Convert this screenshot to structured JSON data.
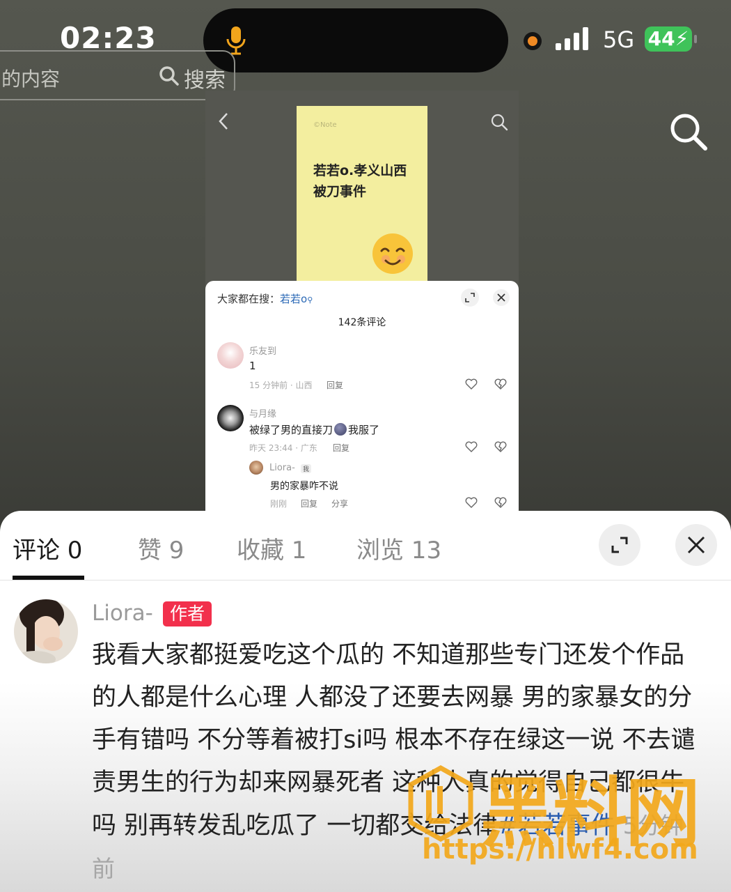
{
  "status_bar": {
    "time": "02:23",
    "network": "5G",
    "battery": "44"
  },
  "background": {
    "search_placeholder": "的内容",
    "search_button": "搜索"
  },
  "embedded": {
    "note_mark": "©Note",
    "note_title": "若若o.孝义山西被刀事件",
    "search_hint_prefix": "大家都在搜：",
    "search_hint_term": "若若o",
    "comment_count": "142条评论",
    "comments": [
      {
        "user": "乐友到",
        "text": "1",
        "meta": "15 分钟前 · 山西",
        "reply": "回复"
      },
      {
        "user": "与月缘",
        "text_before": "被绿了男的直接刀",
        "text_after": "我服了",
        "meta": "昨天 23:44 · 广东",
        "reply": "回复"
      }
    ],
    "sub_reply": {
      "user": "Liora-",
      "badge": "我",
      "text": "男的家暴咋不说",
      "meta": "刚刚",
      "reply": "回复",
      "share": "分享"
    }
  },
  "tabs": [
    {
      "label": "评论 0",
      "active": true
    },
    {
      "label": "赞 9",
      "active": false
    },
    {
      "label": "收藏 1",
      "active": false
    },
    {
      "label": "浏览 13",
      "active": false
    }
  ],
  "main_comment": {
    "author": "Liora-",
    "badge": "作者",
    "text": "我看大家都挺爱吃这个瓜的 不知道那些专门还发个作品的人都是什么心理 人都没了还要去网暴 男的家暴女的分手有错吗 不分等着被打si吗 根本不存在绿这一说 不去谴责男生的行为却来网暴死者 这种人真的觉得自己都很牛吗 别再转发乱吃瓜了 一切都交给法律",
    "hashtag": "#若若事件",
    "time": "5分钟前"
  },
  "watermark": {
    "name": "黑料网",
    "url": "https://hlwf4.com"
  },
  "colors": {
    "author_badge": "#f2304c",
    "hashtag": "#2a5db0",
    "battery": "#3fc35a",
    "watermark": "#f3a81b",
    "note": "#f3ee9f"
  }
}
